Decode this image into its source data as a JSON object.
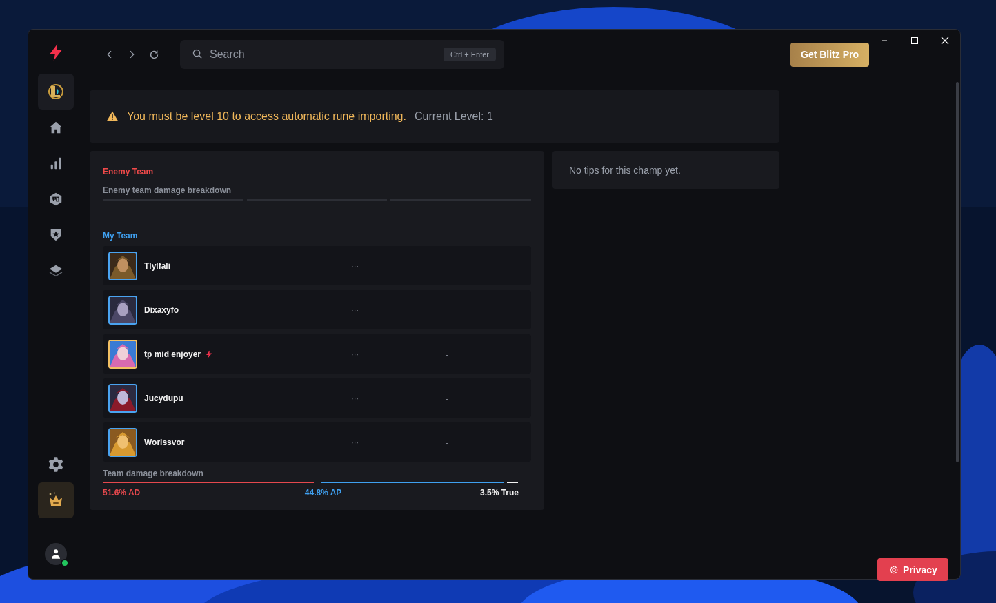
{
  "sidebar": {
    "top_items": [
      {
        "selected": true
      },
      {
        "selected": false
      },
      {
        "selected": false
      },
      {
        "selected": false
      },
      {
        "selected": false
      },
      {
        "selected": false
      }
    ],
    "bottom_items": [
      {
        "selected": false
      },
      {
        "selected": true
      }
    ],
    "user": {
      "online": true
    }
  },
  "search": {
    "placeholder": "Search",
    "shortcut": "Ctrl + Enter"
  },
  "pro_button": "Get Blitz Pro",
  "banner": {
    "warning": "You must be level 10 to access automatic rune importing.",
    "current_level": "Current Level: 1"
  },
  "enemy_team": {
    "title": "Enemy Team",
    "subtitle": "Enemy team damage breakdown"
  },
  "my_team": {
    "title": "My Team",
    "players": [
      {
        "name": "Tlylfali",
        "highlighted": false,
        "premium": false,
        "column_2": "···",
        "column_3": "-"
      },
      {
        "name": "Dixaxyfo",
        "highlighted": false,
        "premium": false,
        "column_2": "···",
        "column_3": "-"
      },
      {
        "name": "tp mid enjoyer",
        "highlighted": true,
        "premium": true,
        "column_2": "···",
        "column_3": "-"
      },
      {
        "name": "Jucydupu",
        "highlighted": false,
        "premium": false,
        "column_2": "···",
        "column_3": "-"
      },
      {
        "name": "Worissvor",
        "highlighted": false,
        "premium": false,
        "column_2": "···",
        "column_3": "-"
      }
    ],
    "breakdown_title": "Team damage breakdown",
    "breakdown": [
      {
        "label": "51.6% AD",
        "color": "#e5484d"
      },
      {
        "label": "44.8% AP",
        "color": "#3fa0f0"
      },
      {
        "label": "3.5% True",
        "color": "#f2f2f2"
      }
    ]
  },
  "tips": "No tips for this champ yet.",
  "privacy_button": "Privacy"
}
